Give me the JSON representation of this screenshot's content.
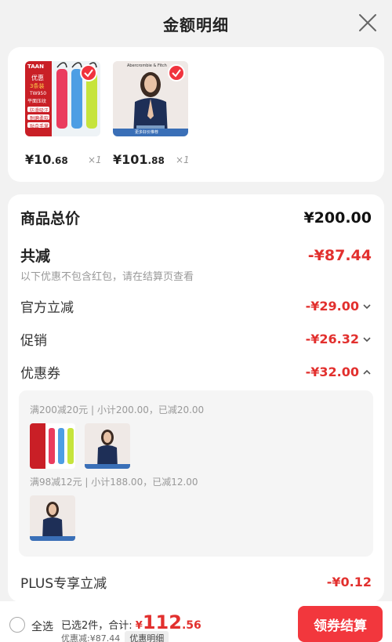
{
  "header": {
    "title": "金额明细"
  },
  "products": [
    {
      "price_int": "¥10",
      "price_dec": ".68",
      "qty": "×1",
      "ad_text": "TAAN",
      "ad_badge": "优惠",
      "ad_sub": "3条装",
      "ad_model": "TW950",
      "ad_desc": "平面压纹",
      "ad_lines": [
        "防滑吸汗",
        "耐磨柔软",
        "贴合手掌"
      ]
    },
    {
      "price_int": "¥101",
      "price_dec": ".88",
      "qty": "×1",
      "brand": "Abercrombie & Fitch",
      "tag": "更多好价推荐"
    }
  ],
  "summary": {
    "total_label": "商品总价",
    "total_value": "¥200.00",
    "discount_label": "共减",
    "discount_value": "-¥87.44",
    "note": "以下优惠不包含红包，请在结算页查看",
    "official_label": "官方立减",
    "official_value": "-¥29.00",
    "promo_label": "促销",
    "promo_value": "-¥26.32",
    "coupon_label": "优惠券",
    "coupon_value": "-¥32.00",
    "plus_label": "PLUS专享立减",
    "plus_value": "-¥0.12"
  },
  "coupons": [
    {
      "text": "满200减20元 | 小计200.00，已减20.00"
    },
    {
      "text": "满98减12元 | 小计188.00，已减12.00"
    }
  ],
  "bottom": {
    "select_all": "全选",
    "selected_text": "已选2件，合计:",
    "yen": "¥",
    "amount_int": "112",
    "amount_dec": ".56",
    "discount_text": "优惠减:¥87.44",
    "detail_tag": "优惠明细",
    "checkout_label": "领券结算"
  },
  "colors": {
    "accent": "#f2373d",
    "discount_red": "#e2302e"
  }
}
